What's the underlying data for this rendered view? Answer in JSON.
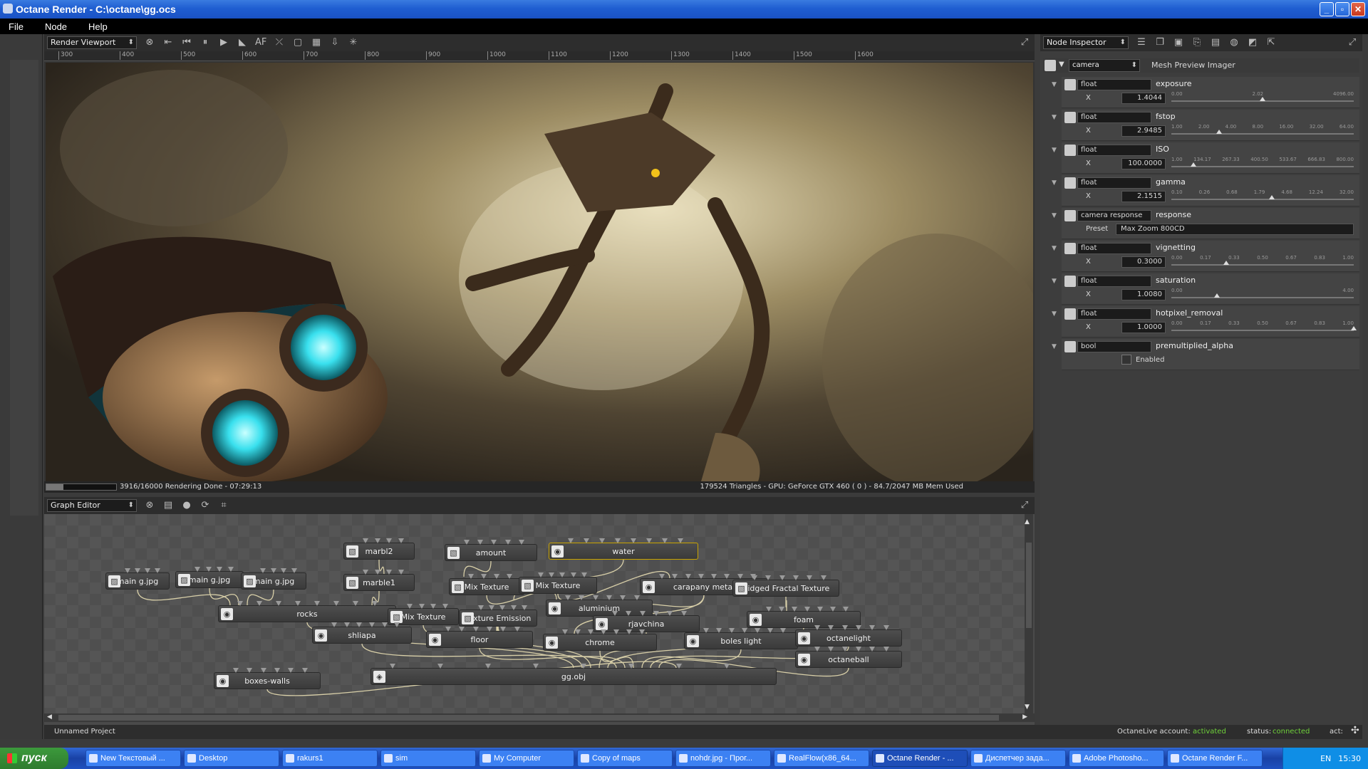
{
  "window": {
    "title": "Octane Render - C:\\octane\\gg.ocs"
  },
  "menu": [
    "File",
    "Node",
    "Help"
  ],
  "viewport": {
    "panel": "Render Viewport",
    "ruler": [
      "300",
      "400",
      "500",
      "600",
      "700",
      "800",
      "900",
      "1000",
      "1100",
      "1200",
      "1300",
      "1400",
      "1500",
      "1600"
    ],
    "status_left": "3916/16000 Rendering Done - 07:29:13",
    "status_right": "179524 Triangles - GPU: GeForce GTX 460 ( 0 ) - 84.7/2047 MB Mem Used"
  },
  "graph": {
    "panel": "Graph Editor",
    "nodes": [
      {
        "label": "marbl2",
        "icon": "texture"
      },
      {
        "label": "amount",
        "icon": "texture"
      },
      {
        "label": "water",
        "icon": "material"
      },
      {
        "label": "main g.jpg",
        "icon": "image"
      },
      {
        "label": "main g.jpg",
        "icon": "image"
      },
      {
        "label": "main g.jpg",
        "icon": "image"
      },
      {
        "label": "marble1",
        "icon": "texture"
      },
      {
        "label": "Mix Texture",
        "icon": "texture"
      },
      {
        "label": "Mix Texture",
        "icon": "texture"
      },
      {
        "label": "carapany metal",
        "icon": "material"
      },
      {
        "label": "Ridged Fractal Texture",
        "icon": "texture"
      },
      {
        "label": "aluminium",
        "icon": "material"
      },
      {
        "label": "rocks",
        "icon": "material"
      },
      {
        "label": "Mix Texture",
        "icon": "texture"
      },
      {
        "label": "Texture Emission",
        "icon": "texture"
      },
      {
        "label": "rjavchina",
        "icon": "material"
      },
      {
        "label": "foam",
        "icon": "material"
      },
      {
        "label": "shliapa",
        "icon": "material"
      },
      {
        "label": "floor",
        "icon": "material"
      },
      {
        "label": "chrome",
        "icon": "material"
      },
      {
        "label": "boles light",
        "icon": "material"
      },
      {
        "label": "octanelight",
        "icon": "material"
      },
      {
        "label": "octaneball",
        "icon": "material"
      },
      {
        "label": "gg.obj",
        "icon": "mesh"
      },
      {
        "label": "boxes-walls",
        "icon": "material"
      }
    ]
  },
  "inspector": {
    "panel": "Node Inspector",
    "node_type": "camera",
    "node_name": "Mesh Preview Imager",
    "params": [
      {
        "type": "float",
        "name": "exposure",
        "axis": "X",
        "value": "1.4044",
        "ticks": [
          "0.00",
          "2.02",
          "4096.00"
        ],
        "level": 0.5
      },
      {
        "type": "float",
        "name": "fstop",
        "axis": "X",
        "value": "2.9485",
        "ticks": [
          "1.00",
          "2.00",
          "4.00",
          "8.00",
          "16.00",
          "32.00",
          "64.00"
        ],
        "level": 0.26
      },
      {
        "type": "float",
        "name": "ISO",
        "axis": "X",
        "value": "100.0000",
        "ticks": [
          "1.00",
          "134.17",
          "267.33",
          "400.50",
          "533.67",
          "666.83",
          "800.00"
        ],
        "level": 0.12
      },
      {
        "type": "float",
        "name": "gamma",
        "axis": "X",
        "value": "2.1515",
        "ticks": [
          "0.10",
          "0.26",
          "0.68",
          "1.79",
          "4.68",
          "12.24",
          "32.00"
        ],
        "level": 0.55
      },
      {
        "type": "camera response",
        "name": "response",
        "axis": "Preset",
        "value": "Max Zoom 800CD"
      },
      {
        "type": "float",
        "name": "vignetting",
        "axis": "X",
        "value": "0.3000",
        "ticks": [
          "0.00",
          "0.17",
          "0.33",
          "0.50",
          "0.67",
          "0.83",
          "1.00"
        ],
        "level": 0.3
      },
      {
        "type": "float",
        "name": "saturation",
        "axis": "X",
        "value": "1.0080",
        "ticks": [
          "0.00",
          "4.00"
        ],
        "level": 0.25
      },
      {
        "type": "float",
        "name": "hotpixel_removal",
        "axis": "X",
        "value": "1.0000",
        "ticks": [
          "0.00",
          "0.17",
          "0.33",
          "0.50",
          "0.67",
          "0.83",
          "1.00"
        ],
        "level": 1.0
      },
      {
        "type": "bool",
        "name": "premultiplied_alpha",
        "axis": "",
        "value": "Enabled"
      }
    ]
  },
  "footer": {
    "project": "Unnamed Project",
    "account_label": "OctaneLive account:",
    "account_value": "activated",
    "status_label": "status:",
    "status_value": "connected",
    "act_label": "act:"
  },
  "taskbar": {
    "start": "пуск",
    "tasks": [
      "New Текстовый ...",
      "Desktop",
      "rakurs1",
      "sim",
      "My Computer",
      "Copy of maps",
      "nohdr.jpg - Прог...",
      "RealFlow(x86_64...",
      "Octane Render - ...",
      "Диспетчер зада...",
      "Adobe Photosho...",
      "Octane Render F..."
    ],
    "active_task": 8,
    "lang": "EN",
    "clock": "15:30"
  },
  "colors": {
    "accent_green": "#6fd13a",
    "active_yellow": "#c9a400"
  }
}
